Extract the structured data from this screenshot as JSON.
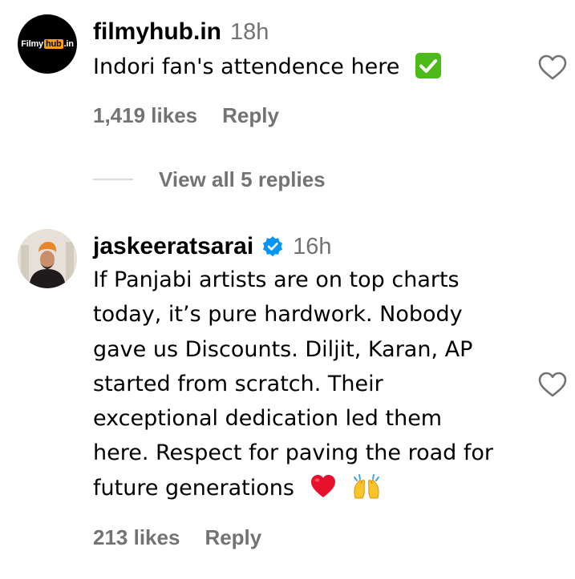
{
  "comments": [
    {
      "avatar": {
        "logo_left": "Filmy",
        "logo_mid": "hub",
        "logo_right": ".in"
      },
      "username": "filmyhub.in",
      "time": "18h",
      "text": "Indori fan's attendence here",
      "emoji": [
        "check-mark-button-emoji"
      ],
      "likes": "1,419 likes",
      "reply_label": "Reply",
      "view_replies": "View all 5 replies"
    },
    {
      "username": "jaskeeratsarai",
      "verified": true,
      "time": "16h",
      "text": "If Panjabi artists are on top charts today, it’s pure hardwork. Nobody gave us Discounts. Diljit, Karan, AP started from scratch. Their exceptional dedication led them here. Respect for paving the road for future generations",
      "emoji": [
        "red-heart-emoji",
        "raising-hands-emoji"
      ],
      "likes": "213 likes",
      "reply_label": "Reply"
    }
  ],
  "colors": {
    "text": "#000000",
    "secondary": "#737373",
    "verified_blue": "#0095f6",
    "divider": "#dbdbdb",
    "check_green": "#4cbb17",
    "heart_red": "#e8112d",
    "hands_yellow": "#f9c429",
    "logo_orange": "#f7a10e"
  }
}
